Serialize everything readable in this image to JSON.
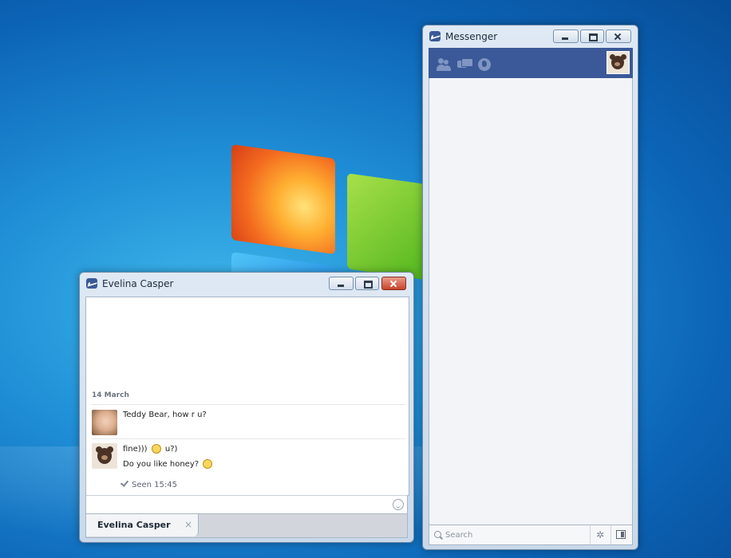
{
  "chat_window": {
    "title": "Evelina Casper",
    "date_label": "14 March",
    "messages": [
      {
        "sender": "Evelina Casper",
        "text": "Teddy Bear, how r u?"
      },
      {
        "sender": "Teddy Bear",
        "line1_part1": "fine)))",
        "line1_part2": "u?)",
        "line2": "Do you like honey?"
      }
    ],
    "seen_label": "Seen 15:45",
    "tab_label": "Evelina Casper",
    "tab_close": "×"
  },
  "messenger_window": {
    "title": "Messenger",
    "toolbar_icons": [
      "friends-icon",
      "messages-icon",
      "notifications-globe-icon"
    ],
    "search_placeholder": "Search",
    "gear_glyph": "✲"
  },
  "colors": {
    "facebook_blue": "#3b5998",
    "close_button_red": "#c8442a"
  }
}
